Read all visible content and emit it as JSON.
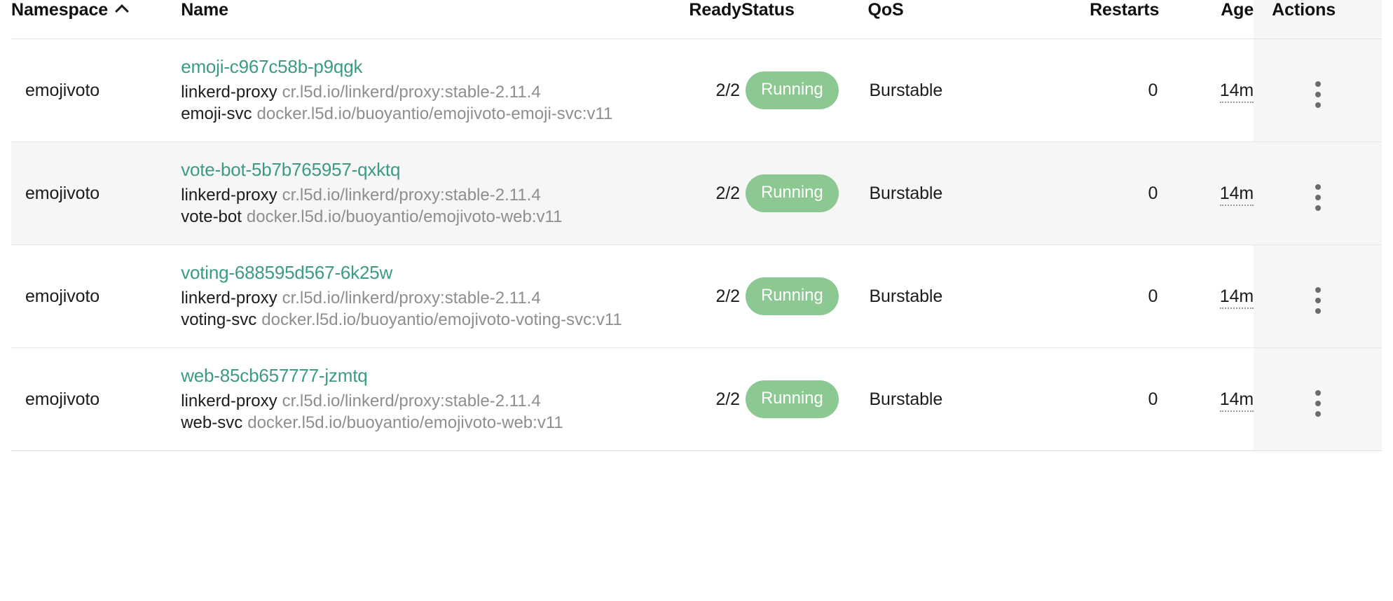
{
  "table": {
    "columns": [
      {
        "key": "namespace",
        "label": "Namespace",
        "sorted": true,
        "sort_direction": "asc",
        "sort_icon": "chevron-up-icon",
        "align": "left"
      },
      {
        "key": "name",
        "label": "Name",
        "align": "left"
      },
      {
        "key": "ready",
        "label": "Ready",
        "align": "right"
      },
      {
        "key": "status",
        "label": "Status",
        "align": "left"
      },
      {
        "key": "qos",
        "label": "QoS",
        "align": "left"
      },
      {
        "key": "restarts",
        "label": "Restarts",
        "align": "right"
      },
      {
        "key": "age",
        "label": "Age",
        "align": "right"
      },
      {
        "key": "actions",
        "label": "Actions",
        "align": "left"
      }
    ],
    "colors": {
      "link": "#3c9a85",
      "status_running_bg": "#8cc892",
      "status_running_text": "#ffffff",
      "stripe_bg": "#f6f6f6",
      "sticky_column_bg": "#f6f6f6",
      "muted_text": "#8e8e8e",
      "border": "#e7e7e7"
    },
    "rows": [
      {
        "namespace": "emojivoto",
        "name": "emoji-c967c58b-p9qgk",
        "containers": [
          {
            "name": "linkerd-proxy",
            "image": "cr.l5d.io/linkerd/proxy:stable-2.11.4"
          },
          {
            "name": "emoji-svc",
            "image": "docker.l5d.io/buoyantio/emojivoto-emoji-svc:v11"
          }
        ],
        "ready": "2/2",
        "status": "Running",
        "qos": "Burstable",
        "restarts": "0",
        "age": "14m",
        "actions_icon": "kebab-menu-icon"
      },
      {
        "namespace": "emojivoto",
        "name": "vote-bot-5b7b765957-qxktq",
        "containers": [
          {
            "name": "linkerd-proxy",
            "image": "cr.l5d.io/linkerd/proxy:stable-2.11.4"
          },
          {
            "name": "vote-bot",
            "image": "docker.l5d.io/buoyantio/emojivoto-web:v11"
          }
        ],
        "ready": "2/2",
        "status": "Running",
        "qos": "Burstable",
        "restarts": "0",
        "age": "14m",
        "actions_icon": "kebab-menu-icon"
      },
      {
        "namespace": "emojivoto",
        "name": "voting-688595d567-6k25w",
        "containers": [
          {
            "name": "linkerd-proxy",
            "image": "cr.l5d.io/linkerd/proxy:stable-2.11.4"
          },
          {
            "name": "voting-svc",
            "image": "docker.l5d.io/buoyantio/emojivoto-voting-svc:v11"
          }
        ],
        "ready": "2/2",
        "status": "Running",
        "qos": "Burstable",
        "restarts": "0",
        "age": "14m",
        "actions_icon": "kebab-menu-icon"
      },
      {
        "namespace": "emojivoto",
        "name": "web-85cb657777-jzmtq",
        "containers": [
          {
            "name": "linkerd-proxy",
            "image": "cr.l5d.io/linkerd/proxy:stable-2.11.4"
          },
          {
            "name": "web-svc",
            "image": "docker.l5d.io/buoyantio/emojivoto-web:v11"
          }
        ],
        "ready": "2/2",
        "status": "Running",
        "qos": "Burstable",
        "restarts": "0",
        "age": "14m",
        "actions_icon": "kebab-menu-icon"
      }
    ]
  }
}
